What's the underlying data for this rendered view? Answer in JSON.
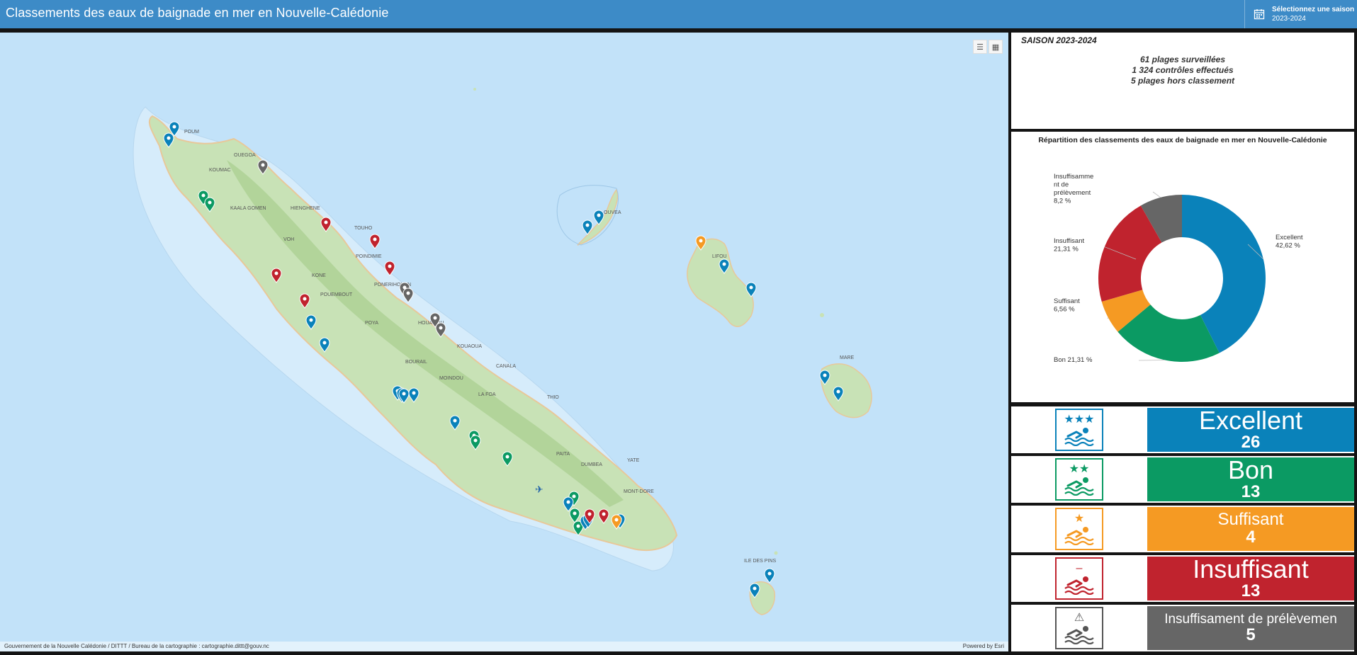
{
  "header": {
    "title": "Classements des eaux de baignade en mer en Nouvelle-Calédonie",
    "season_label": "Sélectionnez une saison",
    "season_value": "2023-2024"
  },
  "map": {
    "attribution": "Gouvernement de la Nouvelle Calédonie / DITTT / Bureau de la cartographie : cartographie.dittt@gouv.nc",
    "powered_by": "Powered by Esri",
    "place_labels": [
      "POUM",
      "OUEGOA",
      "KOUMAC",
      "KAALA GOMEN",
      "HIENGHENE",
      "TOUHO",
      "VOH",
      "POINDIMIE",
      "PONERIHOUEN",
      "KONE",
      "POUEMBOUT",
      "POYA",
      "HOUAILOU",
      "BOURAIL",
      "KOUAOUA",
      "CANALA",
      "MOINDOU",
      "LA FOA",
      "THIO",
      "PAITA",
      "DUMBEA",
      "YATE",
      "MONT-DORE",
      "OUVEA",
      "LIFOU",
      "MARE",
      "ILE DES PINS"
    ],
    "marker_colors": {
      "excellent": "#0a82ba",
      "bon": "#0b9a63",
      "suffisant": "#f59a23",
      "insuffisant": "#c0232e",
      "prelevement": "#666666"
    }
  },
  "stats": {
    "season": "SAISON 2023-2024",
    "line1": "61 plages surveillées",
    "line2": "1 324 contrôles effectués",
    "line3": "5 plages hors classement"
  },
  "chart_data": {
    "type": "pie",
    "title": "Répartition des classements des eaux de baignade en mer en Nouvelle-Calédonie",
    "donut": true,
    "series": [
      {
        "name": "Excellent",
        "value": 42.62,
        "label": "Excellent\n42,62 %",
        "color": "#0a82ba"
      },
      {
        "name": "Bon",
        "value": 21.31,
        "label": "Bon 21,31 %",
        "color": "#0b9a63"
      },
      {
        "name": "Suffisant",
        "value": 6.56,
        "label": "Suffisant\n6,56 %",
        "color": "#f59a23"
      },
      {
        "name": "Insuffisant",
        "value": 21.31,
        "label": "Insuffisant\n21,31 %",
        "color": "#c0232e"
      },
      {
        "name": "Insuffisamment de prélèvement",
        "value": 8.2,
        "label": "Insuffisamme\nnt de\nprélèvement\n8,2 %",
        "color": "#666666"
      }
    ]
  },
  "categories": [
    {
      "key": "excellent",
      "name": "Excellent",
      "count": "26",
      "color": "#0a82ba",
      "stars": "★★★"
    },
    {
      "key": "bon",
      "name": "Bon",
      "count": "13",
      "color": "#0b9a63",
      "stars": "★★"
    },
    {
      "key": "suffisant",
      "name": "Suffisant",
      "count": "4",
      "color": "#f59a23",
      "stars": "★"
    },
    {
      "key": "insuffisant",
      "name": "Insuffisant",
      "count": "13",
      "color": "#c0232e",
      "stars": "–"
    },
    {
      "key": "prelevement",
      "name": "Insuffisament de prélèvemen",
      "count": "5",
      "color": "#666666",
      "stars": "⚠"
    }
  ]
}
